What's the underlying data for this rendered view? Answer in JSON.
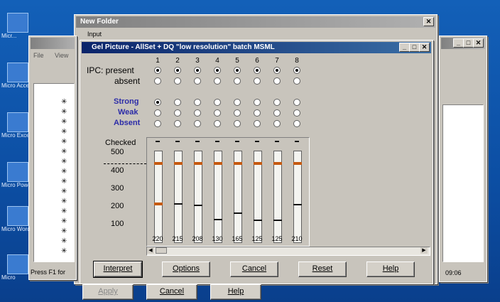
{
  "desktop": {
    "icons": [
      {
        "label": "Micr...",
        "name": "my-computer-icon"
      },
      {
        "label": "Micro Acce",
        "name": "access-icon"
      },
      {
        "label": "Micro Exce",
        "name": "excel-icon"
      },
      {
        "label": "Micro Powe",
        "name": "powerpoint-icon"
      },
      {
        "label": "Micro Word",
        "name": "word-icon"
      },
      {
        "label": "Micro",
        "name": "office-icon"
      }
    ]
  },
  "bg_window": {
    "title": "New Folder",
    "partial": "Input",
    "status": "Press F1 for"
  },
  "right_window": {
    "time": "09:06"
  },
  "dialog": {
    "title": "Gel Picture - AllSet + DQ \"low resolution\" batch MSML",
    "ipc_label": "IPC: present",
    "absent_label": "absent",
    "lanes": [
      "1",
      "2",
      "3",
      "4",
      "5",
      "6",
      "7",
      "8"
    ],
    "ipc_present": [
      true,
      true,
      true,
      true,
      true,
      true,
      true,
      true
    ],
    "strength_labels": [
      "Strong",
      "Weak",
      "Absent"
    ],
    "strong_selected": [
      true,
      false,
      false,
      false,
      false,
      false,
      false,
      false
    ],
    "checked_label": "Checked",
    "y_ticks": [
      "500",
      "400",
      "300",
      "200",
      "100"
    ],
    "lane_values": [
      "220",
      "215",
      "208",
      "130",
      "165",
      "125",
      "125",
      "210"
    ],
    "lane_levels": [
      0.44,
      0.43,
      0.416,
      0.26,
      0.33,
      0.25,
      0.25,
      0.42
    ],
    "buttons": {
      "interpret": "Interpret",
      "options": "Options",
      "cancel": "Cancel",
      "reset": "Reset",
      "help": "Help"
    }
  },
  "bottom_buttons": {
    "apply": "Apply",
    "cancel": "Cancel",
    "help": "Help"
  },
  "colors": {
    "threshold": "#c55a11",
    "titlebar": "#0a246a"
  }
}
